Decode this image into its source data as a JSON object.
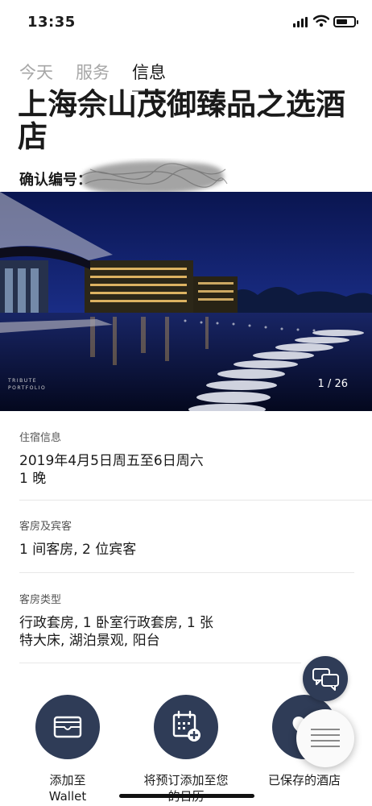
{
  "status_bar": {
    "time": "13:35"
  },
  "tabs": [
    {
      "label": "今天",
      "active": false
    },
    {
      "label": "服务",
      "active": false
    },
    {
      "label": "信息",
      "active": true
    }
  ],
  "hotel": {
    "title": "上海佘山茂御臻品之选酒店",
    "confirmation_label": "确认编号："
  },
  "photo": {
    "counter": "1 / 26",
    "brand_lines": [
      "TRIBUTE",
      "PORTFOLIO"
    ]
  },
  "stay_info": {
    "label": "住宿信息",
    "dates": "2019年4月5日周五至6日周六",
    "nights": "1 晚"
  },
  "rooms_guests": {
    "label": "客房及宾客",
    "value": "1 间客房, 2 位宾客"
  },
  "room_type": {
    "label": "客房类型",
    "value_line1": "行政套房, 1 卧室行政套房, 1  张",
    "value_line2": "特大床, 湖泊景观, 阳台"
  },
  "actions": {
    "wallet_line1": "添加至",
    "wallet_line2": "Wallet",
    "calendar_line1": "将预订添加至您",
    "calendar_line2": "的日历",
    "saved": "已保存的酒店"
  },
  "icons": {
    "wallet": "wallet-icon",
    "calendar": "calendar-add-icon",
    "saved": "heart-icon",
    "chat": "chat-icon",
    "menu": "menu-icon"
  },
  "colors": {
    "accent": "#2f3c57",
    "tab_inactive": "#a7a7a7",
    "text": "#1a1a1a"
  }
}
